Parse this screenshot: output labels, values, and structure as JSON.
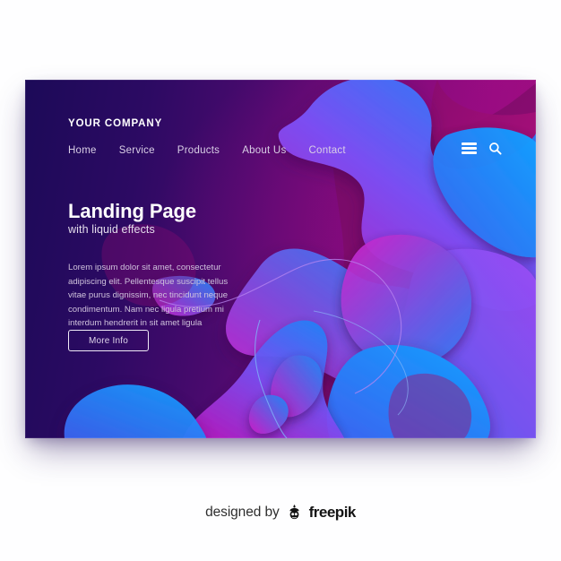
{
  "page": {
    "background_color": "#fefeff"
  },
  "mockup": {
    "background_color": "#1b0a55",
    "accent_magenta": "#c01bb9",
    "accent_blue": "#1f86f5",
    "accent_violet": "#7b5cf0",
    "deep_purple": "#2c0a63",
    "header": {
      "brand": "YOUR COMPANY",
      "nav_items": [
        {
          "label": "Home"
        },
        {
          "label": "Service"
        },
        {
          "label": "Products"
        },
        {
          "label": "About Us"
        },
        {
          "label": "Contact"
        }
      ],
      "icons": [
        {
          "name": "hamburger-menu-icon"
        },
        {
          "name": "search-icon"
        }
      ]
    },
    "hero": {
      "title": "Landing Page",
      "subtitle": "with liquid effects",
      "paragraph": "Lorem ipsum dolor sit amet, consectetur adipiscing elit. Pellentesque suscipit tellus vitae purus dignissim, nec tincidunt neque condimentum. Nam nec ligula pretium mi interdum hendrerit in sit amet ligula",
      "button_label": "More Info"
    }
  },
  "credit": {
    "prefix": "designed by",
    "brand": "freepik",
    "logo_icon": "freepik-robot-face-icon"
  }
}
